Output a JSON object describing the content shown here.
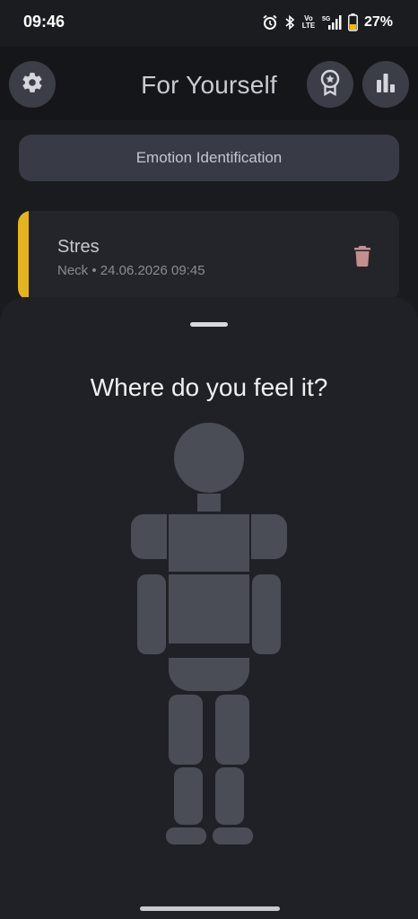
{
  "status_bar": {
    "time": "09:46",
    "network": "5G",
    "volte": "Vo LTE",
    "battery_percent": "27%",
    "icons": [
      "alarm-icon",
      "bluetooth-icon",
      "volte-icon",
      "signal-icon",
      "battery-icon"
    ]
  },
  "header": {
    "title": "For Yourself",
    "left_icon": "gear-icon",
    "right_icons": [
      "award-icon",
      "bar-chart-icon"
    ]
  },
  "emotion_button": {
    "label": "Emotion Identification"
  },
  "entry": {
    "title": "Stres",
    "subtitle": "Neck • 24.06.2026 09:45",
    "accent_color": "#e3b321",
    "action_icon": "trash-icon"
  },
  "sheet": {
    "question": "Where do you feel it?",
    "body_parts": [
      "head",
      "neck",
      "left-shoulder",
      "right-shoulder",
      "chest",
      "left-arm",
      "right-arm",
      "abdomen",
      "pelvis",
      "left-thigh",
      "right-thigh",
      "left-shin",
      "right-shin",
      "left-foot",
      "right-foot"
    ]
  },
  "colors": {
    "background": "#1a1b1e",
    "body_part": "#4a4d56",
    "button": "#383b45",
    "accent": "#e3b321",
    "trash": "#c58f8f"
  }
}
